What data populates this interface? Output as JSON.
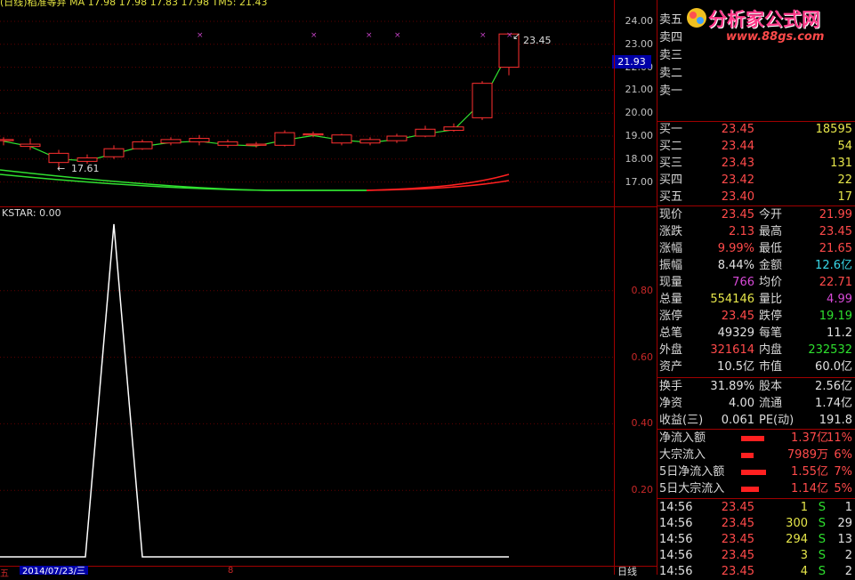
{
  "main_chart": {
    "header_text": "(日线)稻准等弃 MA 17.98 17.98 17.83 17.98 TM5: 21.43",
    "y_ticks": [
      "24.00",
      "23.00",
      "22.00",
      "21.00",
      "20.00",
      "19.00",
      "18.00",
      "17.00"
    ],
    "current_price_tag": "21.93",
    "high_label": "23.45",
    "low_label": "17.61",
    "colors": {
      "up": "#ff3030",
      "down": "#00c8c8",
      "ma_short": "#30e030",
      "ma_long": "#30e030",
      "ma_long_red": "#ff2020",
      "marker": "#c040c0"
    }
  },
  "indicator": {
    "title": "KSTAR: 0.00",
    "y_ticks": [
      "0.80",
      "0.60",
      "0.40",
      "0.20"
    ]
  },
  "bottom_bar": {
    "date_tag": "2014/07/23/三",
    "mark": "8",
    "period": "日线"
  },
  "logo": {
    "title": "分析家公式网",
    "url": "www.88gs.com"
  },
  "order_book": {
    "asks": [
      {
        "label": "卖五",
        "price": "",
        "vol": ""
      },
      {
        "label": "卖四",
        "price": "",
        "vol": ""
      },
      {
        "label": "卖三",
        "price": "",
        "vol": ""
      },
      {
        "label": "卖二",
        "price": "",
        "vol": ""
      },
      {
        "label": "卖一",
        "price": "",
        "vol": ""
      }
    ],
    "bids": [
      {
        "label": "买一",
        "price": "23.45",
        "vol": "18595"
      },
      {
        "label": "买二",
        "price": "23.44",
        "vol": "54"
      },
      {
        "label": "买三",
        "price": "23.43",
        "vol": "131"
      },
      {
        "label": "买四",
        "price": "23.42",
        "vol": "22"
      },
      {
        "label": "买五",
        "price": "23.40",
        "vol": "17"
      }
    ]
  },
  "quote": [
    {
      "l1": "现价",
      "v1": "23.45",
      "l2": "今开",
      "v2": "21.99",
      "c1": "red",
      "c2": "red"
    },
    {
      "l1": "涨跌",
      "v1": "2.13",
      "l2": "最高",
      "v2": "23.45",
      "c1": "red",
      "c2": "red"
    },
    {
      "l1": "涨幅",
      "v1": "9.99%",
      "l2": "最低",
      "v2": "21.65",
      "c1": "red",
      "c2": "red"
    },
    {
      "l1": "振幅",
      "v1": "8.44%",
      "l2": "金额",
      "v2": "12.6亿",
      "c1": "wht",
      "c2": "cyn"
    },
    {
      "l1": "现量",
      "v1": "766",
      "l2": "均价",
      "v2": "22.71",
      "c1": "mag",
      "c2": "red"
    },
    {
      "l1": "总量",
      "v1": "554146",
      "l2": "量比",
      "v2": "4.99",
      "c1": "yel",
      "c2": "mag"
    },
    {
      "l1": "涨停",
      "v1": "23.45",
      "l2": "跌停",
      "v2": "19.19",
      "c1": "red",
      "c2": "grn"
    },
    {
      "l1": "总笔",
      "v1": "49329",
      "l2": "每笔",
      "v2": "11.2",
      "c1": "wht",
      "c2": "wht"
    },
    {
      "l1": "外盘",
      "v1": "321614",
      "l2": "内盘",
      "v2": "232532",
      "c1": "red",
      "c2": "grn"
    },
    {
      "l1": "资产",
      "v1": "10.5亿",
      "l2": "市值",
      "v2": "60.0亿",
      "c1": "wht",
      "c2": "wht"
    }
  ],
  "fundamentals": [
    {
      "l1": "换手",
      "v1": "31.89%",
      "l2": "股本",
      "v2": "2.56亿"
    },
    {
      "l1": "净资",
      "v1": "4.00",
      "l2": "流通",
      "v2": "1.74亿"
    },
    {
      "l1": "收益(三)",
      "v1": "0.061",
      "l2": "PE(动)",
      "v2": "191.8"
    }
  ],
  "fund_flow": [
    {
      "label": "净流入额",
      "value": "1.37亿",
      "pct": "11%"
    },
    {
      "label": "大宗流入",
      "value": "7989万",
      "pct": "6%"
    },
    {
      "label": "5日净流入额",
      "value": "1.55亿",
      "pct": "7%"
    },
    {
      "label": "5日大宗流入",
      "value": "1.14亿",
      "pct": "5%"
    }
  ],
  "ticks": [
    {
      "time": "14:56",
      "price": "23.45",
      "vol": "1",
      "side": "S",
      "n": "1"
    },
    {
      "time": "14:56",
      "price": "23.45",
      "vol": "300",
      "side": "S",
      "n": "29"
    },
    {
      "time": "14:56",
      "price": "23.45",
      "vol": "294",
      "side": "S",
      "n": "13"
    },
    {
      "time": "14:56",
      "price": "23.45",
      "vol": "3",
      "side": "S",
      "n": "2"
    },
    {
      "time": "14:56",
      "price": "23.45",
      "vol": "4",
      "side": "S",
      "n": "2"
    }
  ]
}
